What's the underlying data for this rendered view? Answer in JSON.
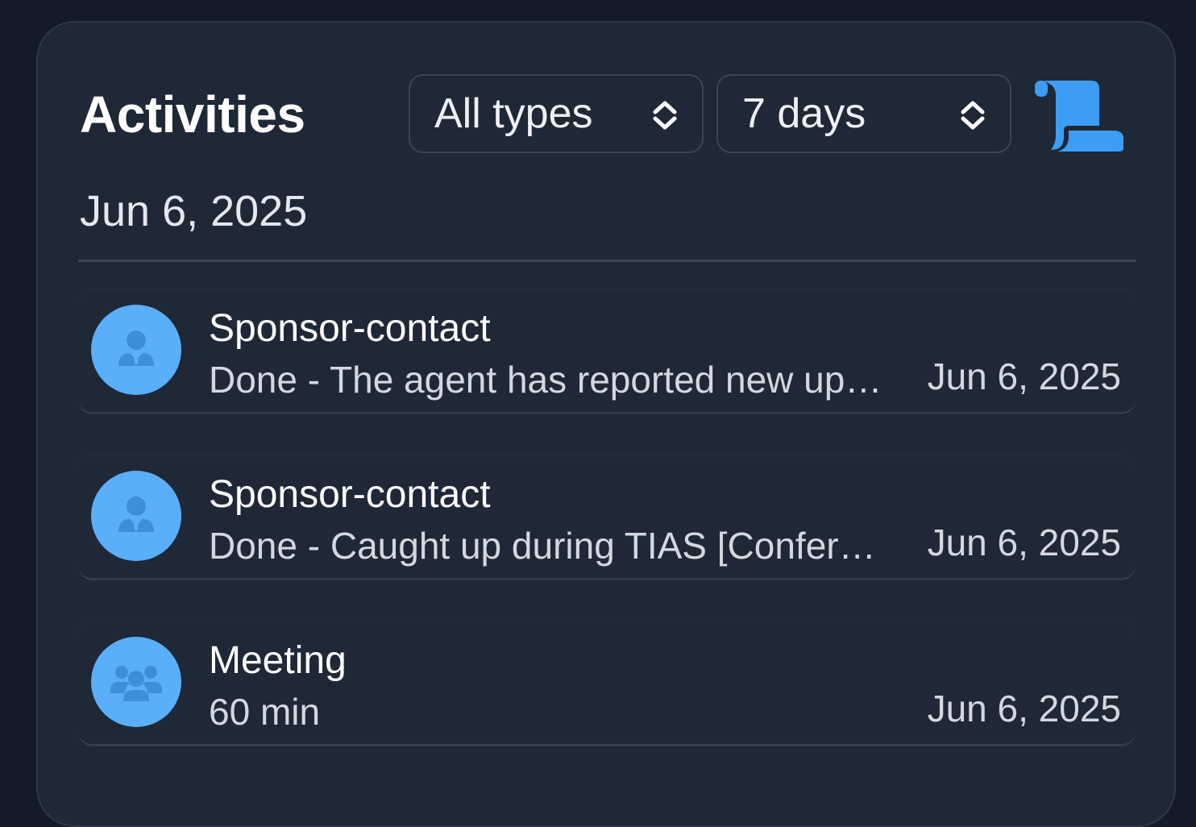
{
  "header": {
    "title": "Activities",
    "type_filter": {
      "selected": "All types",
      "icon": "chevron-up-down-icon"
    },
    "range_filter": {
      "selected": "7 days",
      "icon": "chevron-up-down-icon"
    },
    "scroll_icon": "scroll-icon"
  },
  "colors": {
    "background": "#131a28",
    "card": "#1f2836",
    "accent": "#3d9df2",
    "avatar": "#5aaefa"
  },
  "date_heading": "Jun 6, 2025",
  "activities": [
    {
      "title": "Sponsor-contact",
      "subtitle": "Done - The agent has reported new updates",
      "date": "Jun 6, 2025",
      "icon": "user-tie-icon"
    },
    {
      "title": "Sponsor-contact",
      "subtitle": "Done - Caught up during TIAS [Conference]",
      "date": "Jun 6, 2025",
      "icon": "user-tie-icon"
    },
    {
      "title": "Meeting",
      "subtitle": "60 min",
      "date": "Jun 6, 2025",
      "icon": "people-group-icon"
    }
  ]
}
